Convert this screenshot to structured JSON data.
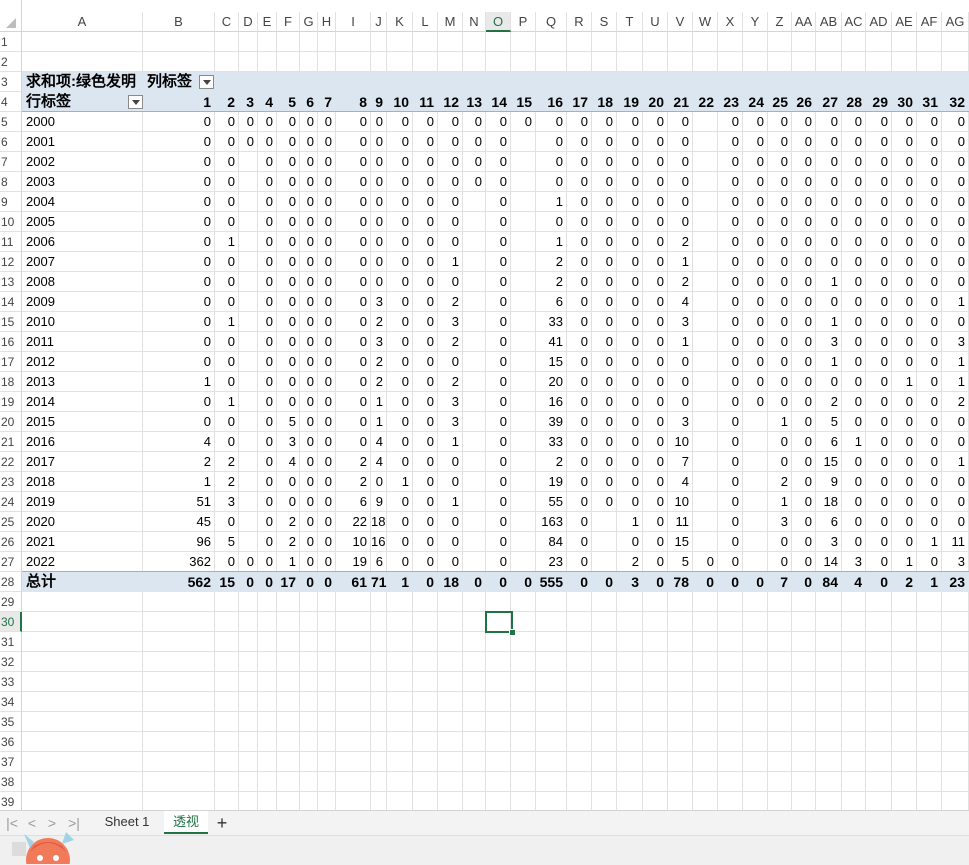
{
  "columns": {
    "letters": [
      "A",
      "B",
      "C",
      "D",
      "E",
      "F",
      "G",
      "H",
      "I",
      "J",
      "K",
      "L",
      "M",
      "N",
      "O",
      "P",
      "Q",
      "R",
      "S",
      "T",
      "U",
      "V",
      "W",
      "X",
      "Y",
      "Z",
      "AA",
      "AB",
      "AC",
      "AD",
      "AE",
      "AF",
      "AG"
    ],
    "active": "O"
  },
  "rows": {
    "numbers": [
      "1",
      "2",
      "3",
      "4",
      "5",
      "6",
      "7",
      "8",
      "9",
      "10",
      "11",
      "12",
      "13",
      "14",
      "15",
      "16",
      "17",
      "18",
      "19",
      "20",
      "21",
      "22",
      "23",
      "24",
      "25",
      "26",
      "27",
      "28",
      "29",
      "30",
      "31",
      "32",
      "33",
      "34",
      "35",
      "36",
      "37",
      "38",
      "39"
    ],
    "active": "30"
  },
  "pivot": {
    "value_field": "求和项:绿色发明",
    "column_label": "列标签",
    "row_label": "行标签",
    "column_headers": [
      "1",
      "2",
      "3",
      "4",
      "5",
      "6",
      "7",
      "8",
      "9",
      "10",
      "11",
      "12",
      "13",
      "14",
      "15",
      "16",
      "17",
      "18",
      "19",
      "20",
      "21",
      "22",
      "23",
      "24",
      "25",
      "26",
      "27",
      "28",
      "29",
      "30",
      "31",
      "32"
    ],
    "rows": [
      {
        "label": "2000",
        "values": [
          "0",
          "0",
          "0",
          "0",
          "0",
          "0",
          "0",
          "0",
          "0",
          "0",
          "0",
          "0",
          "0",
          "0",
          "0",
          "0",
          "0",
          "0",
          "0",
          "0",
          "0",
          "",
          "0",
          "0",
          "0",
          "0",
          "0",
          "0",
          "0",
          "0",
          "0",
          "0"
        ]
      },
      {
        "label": "2001",
        "values": [
          "0",
          "0",
          "0",
          "0",
          "0",
          "0",
          "0",
          "0",
          "0",
          "0",
          "0",
          "0",
          "0",
          "0",
          "",
          "0",
          "0",
          "0",
          "0",
          "0",
          "0",
          "",
          "0",
          "0",
          "0",
          "0",
          "0",
          "0",
          "0",
          "0",
          "0",
          "0"
        ]
      },
      {
        "label": "2002",
        "values": [
          "0",
          "0",
          "",
          "0",
          "0",
          "0",
          "0",
          "0",
          "0",
          "0",
          "0",
          "0",
          "0",
          "0",
          "",
          "0",
          "0",
          "0",
          "0",
          "0",
          "0",
          "",
          "0",
          "0",
          "0",
          "0",
          "0",
          "0",
          "0",
          "0",
          "0",
          "0"
        ]
      },
      {
        "label": "2003",
        "values": [
          "0",
          "0",
          "",
          "0",
          "0",
          "0",
          "0",
          "0",
          "0",
          "0",
          "0",
          "0",
          "0",
          "0",
          "",
          "0",
          "0",
          "0",
          "0",
          "0",
          "0",
          "",
          "0",
          "0",
          "0",
          "0",
          "0",
          "0",
          "0",
          "0",
          "0",
          "0"
        ]
      },
      {
        "label": "2004",
        "values": [
          "0",
          "0",
          "",
          "0",
          "0",
          "0",
          "0",
          "0",
          "0",
          "0",
          "0",
          "0",
          "",
          "0",
          "",
          "1",
          "0",
          "0",
          "0",
          "0",
          "0",
          "",
          "0",
          "0",
          "0",
          "0",
          "0",
          "0",
          "0",
          "0",
          "0",
          "0"
        ]
      },
      {
        "label": "2005",
        "values": [
          "0",
          "0",
          "",
          "0",
          "0",
          "0",
          "0",
          "0",
          "0",
          "0",
          "0",
          "0",
          "",
          "0",
          "",
          "0",
          "0",
          "0",
          "0",
          "0",
          "0",
          "",
          "0",
          "0",
          "0",
          "0",
          "0",
          "0",
          "0",
          "0",
          "0",
          "0"
        ]
      },
      {
        "label": "2006",
        "values": [
          "0",
          "1",
          "",
          "0",
          "0",
          "0",
          "0",
          "0",
          "0",
          "0",
          "0",
          "0",
          "",
          "0",
          "",
          "1",
          "0",
          "0",
          "0",
          "0",
          "2",
          "",
          "0",
          "0",
          "0",
          "0",
          "0",
          "0",
          "0",
          "0",
          "0",
          "0"
        ]
      },
      {
        "label": "2007",
        "values": [
          "0",
          "0",
          "",
          "0",
          "0",
          "0",
          "0",
          "0",
          "0",
          "0",
          "0",
          "1",
          "",
          "0",
          "",
          "2",
          "0",
          "0",
          "0",
          "0",
          "1",
          "",
          "0",
          "0",
          "0",
          "0",
          "0",
          "0",
          "0",
          "0",
          "0",
          "0"
        ]
      },
      {
        "label": "2008",
        "values": [
          "0",
          "0",
          "",
          "0",
          "0",
          "0",
          "0",
          "0",
          "0",
          "0",
          "0",
          "0",
          "",
          "0",
          "",
          "2",
          "0",
          "0",
          "0",
          "0",
          "2",
          "",
          "0",
          "0",
          "0",
          "0",
          "1",
          "0",
          "0",
          "0",
          "0",
          "0"
        ]
      },
      {
        "label": "2009",
        "values": [
          "0",
          "0",
          "",
          "0",
          "0",
          "0",
          "0",
          "0",
          "3",
          "0",
          "0",
          "2",
          "",
          "0",
          "",
          "6",
          "0",
          "0",
          "0",
          "0",
          "4",
          "",
          "0",
          "0",
          "0",
          "0",
          "0",
          "0",
          "0",
          "0",
          "0",
          "1"
        ]
      },
      {
        "label": "2010",
        "values": [
          "0",
          "1",
          "",
          "0",
          "0",
          "0",
          "0",
          "0",
          "2",
          "0",
          "0",
          "3",
          "",
          "0",
          "",
          "33",
          "0",
          "0",
          "0",
          "0",
          "3",
          "",
          "0",
          "0",
          "0",
          "0",
          "1",
          "0",
          "0",
          "0",
          "0",
          "0"
        ]
      },
      {
        "label": "2011",
        "values": [
          "0",
          "0",
          "",
          "0",
          "0",
          "0",
          "0",
          "0",
          "3",
          "0",
          "0",
          "2",
          "",
          "0",
          "",
          "41",
          "0",
          "0",
          "0",
          "0",
          "1",
          "",
          "0",
          "0",
          "0",
          "0",
          "3",
          "0",
          "0",
          "0",
          "0",
          "3"
        ]
      },
      {
        "label": "2012",
        "values": [
          "0",
          "0",
          "",
          "0",
          "0",
          "0",
          "0",
          "0",
          "2",
          "0",
          "0",
          "0",
          "",
          "0",
          "",
          "15",
          "0",
          "0",
          "0",
          "0",
          "0",
          "",
          "0",
          "0",
          "0",
          "0",
          "1",
          "0",
          "0",
          "0",
          "0",
          "1"
        ]
      },
      {
        "label": "2013",
        "values": [
          "1",
          "0",
          "",
          "0",
          "0",
          "0",
          "0",
          "0",
          "2",
          "0",
          "0",
          "2",
          "",
          "0",
          "",
          "20",
          "0",
          "0",
          "0",
          "0",
          "0",
          "",
          "0",
          "0",
          "0",
          "0",
          "0",
          "0",
          "0",
          "1",
          "0",
          "1"
        ]
      },
      {
        "label": "2014",
        "values": [
          "0",
          "1",
          "",
          "0",
          "0",
          "0",
          "0",
          "0",
          "1",
          "0",
          "0",
          "3",
          "",
          "0",
          "",
          "16",
          "0",
          "0",
          "0",
          "0",
          "0",
          "",
          "0",
          "0",
          "0",
          "0",
          "2",
          "0",
          "0",
          "0",
          "0",
          "2"
        ]
      },
      {
        "label": "2015",
        "values": [
          "0",
          "0",
          "",
          "0",
          "5",
          "0",
          "0",
          "0",
          "1",
          "0",
          "0",
          "3",
          "",
          "0",
          "",
          "39",
          "0",
          "0",
          "0",
          "0",
          "3",
          "",
          "0",
          "",
          "1",
          "0",
          "5",
          "0",
          "0",
          "0",
          "0",
          "0"
        ]
      },
      {
        "label": "2016",
        "values": [
          "4",
          "0",
          "",
          "0",
          "3",
          "0",
          "0",
          "0",
          "4",
          "0",
          "0",
          "1",
          "",
          "0",
          "",
          "33",
          "0",
          "0",
          "0",
          "0",
          "10",
          "",
          "0",
          "",
          "0",
          "0",
          "6",
          "1",
          "0",
          "0",
          "0",
          "0"
        ]
      },
      {
        "label": "2017",
        "values": [
          "2",
          "2",
          "",
          "0",
          "4",
          "0",
          "0",
          "2",
          "4",
          "0",
          "0",
          "0",
          "",
          "0",
          "",
          "2",
          "0",
          "0",
          "0",
          "0",
          "7",
          "",
          "0",
          "",
          "0",
          "0",
          "15",
          "0",
          "0",
          "0",
          "0",
          "1"
        ]
      },
      {
        "label": "2018",
        "values": [
          "1",
          "2",
          "",
          "0",
          "0",
          "0",
          "0",
          "2",
          "0",
          "1",
          "0",
          "0",
          "",
          "0",
          "",
          "19",
          "0",
          "0",
          "0",
          "0",
          "4",
          "",
          "0",
          "",
          "2",
          "0",
          "9",
          "0",
          "0",
          "0",
          "0",
          "0"
        ]
      },
      {
        "label": "2019",
        "values": [
          "51",
          "3",
          "",
          "0",
          "0",
          "0",
          "0",
          "6",
          "9",
          "0",
          "0",
          "1",
          "",
          "0",
          "",
          "55",
          "0",
          "0",
          "0",
          "0",
          "10",
          "",
          "0",
          "",
          "1",
          "0",
          "18",
          "0",
          "0",
          "0",
          "0",
          "0"
        ]
      },
      {
        "label": "2020",
        "values": [
          "45",
          "0",
          "",
          "0",
          "2",
          "0",
          "0",
          "22",
          "18",
          "0",
          "0",
          "0",
          "",
          "0",
          "",
          "163",
          "0",
          "",
          "1",
          "0",
          "11",
          "",
          "0",
          "",
          "3",
          "0",
          "6",
          "0",
          "0",
          "0",
          "0",
          "0"
        ]
      },
      {
        "label": "2021",
        "values": [
          "96",
          "5",
          "",
          "0",
          "2",
          "0",
          "0",
          "10",
          "16",
          "0",
          "0",
          "0",
          "",
          "0",
          "",
          "84",
          "0",
          "",
          "0",
          "0",
          "15",
          "",
          "0",
          "",
          "0",
          "0",
          "3",
          "0",
          "0",
          "0",
          "1",
          "11"
        ]
      },
      {
        "label": "2022",
        "values": [
          "362",
          "0",
          "0",
          "0",
          "1",
          "0",
          "0",
          "19",
          "6",
          "0",
          "0",
          "0",
          "",
          "0",
          "",
          "23",
          "0",
          "",
          "2",
          "0",
          "5",
          "0",
          "0",
          "",
          "0",
          "0",
          "14",
          "3",
          "0",
          "1",
          "0",
          "3"
        ]
      }
    ],
    "total_label": "总计",
    "totals": [
      "562",
      "15",
      "0",
      "0",
      "17",
      "0",
      "0",
      "61",
      "71",
      "1",
      "0",
      "18",
      "0",
      "0",
      "0",
      "555",
      "0",
      "0",
      "3",
      "0",
      "78",
      "0",
      "0",
      "0",
      "7",
      "0",
      "84",
      "4",
      "0",
      "2",
      "1",
      "23"
    ]
  },
  "tabs": {
    "items": [
      "Sheet 1",
      "透视"
    ],
    "active_index": 1,
    "add_label": "+",
    "nav": [
      "|<",
      "<",
      ">",
      ">|"
    ]
  },
  "colors": {
    "accent": "#217346",
    "pivot_band": "#dce6f1",
    "grid": "#e1e1e1"
  }
}
